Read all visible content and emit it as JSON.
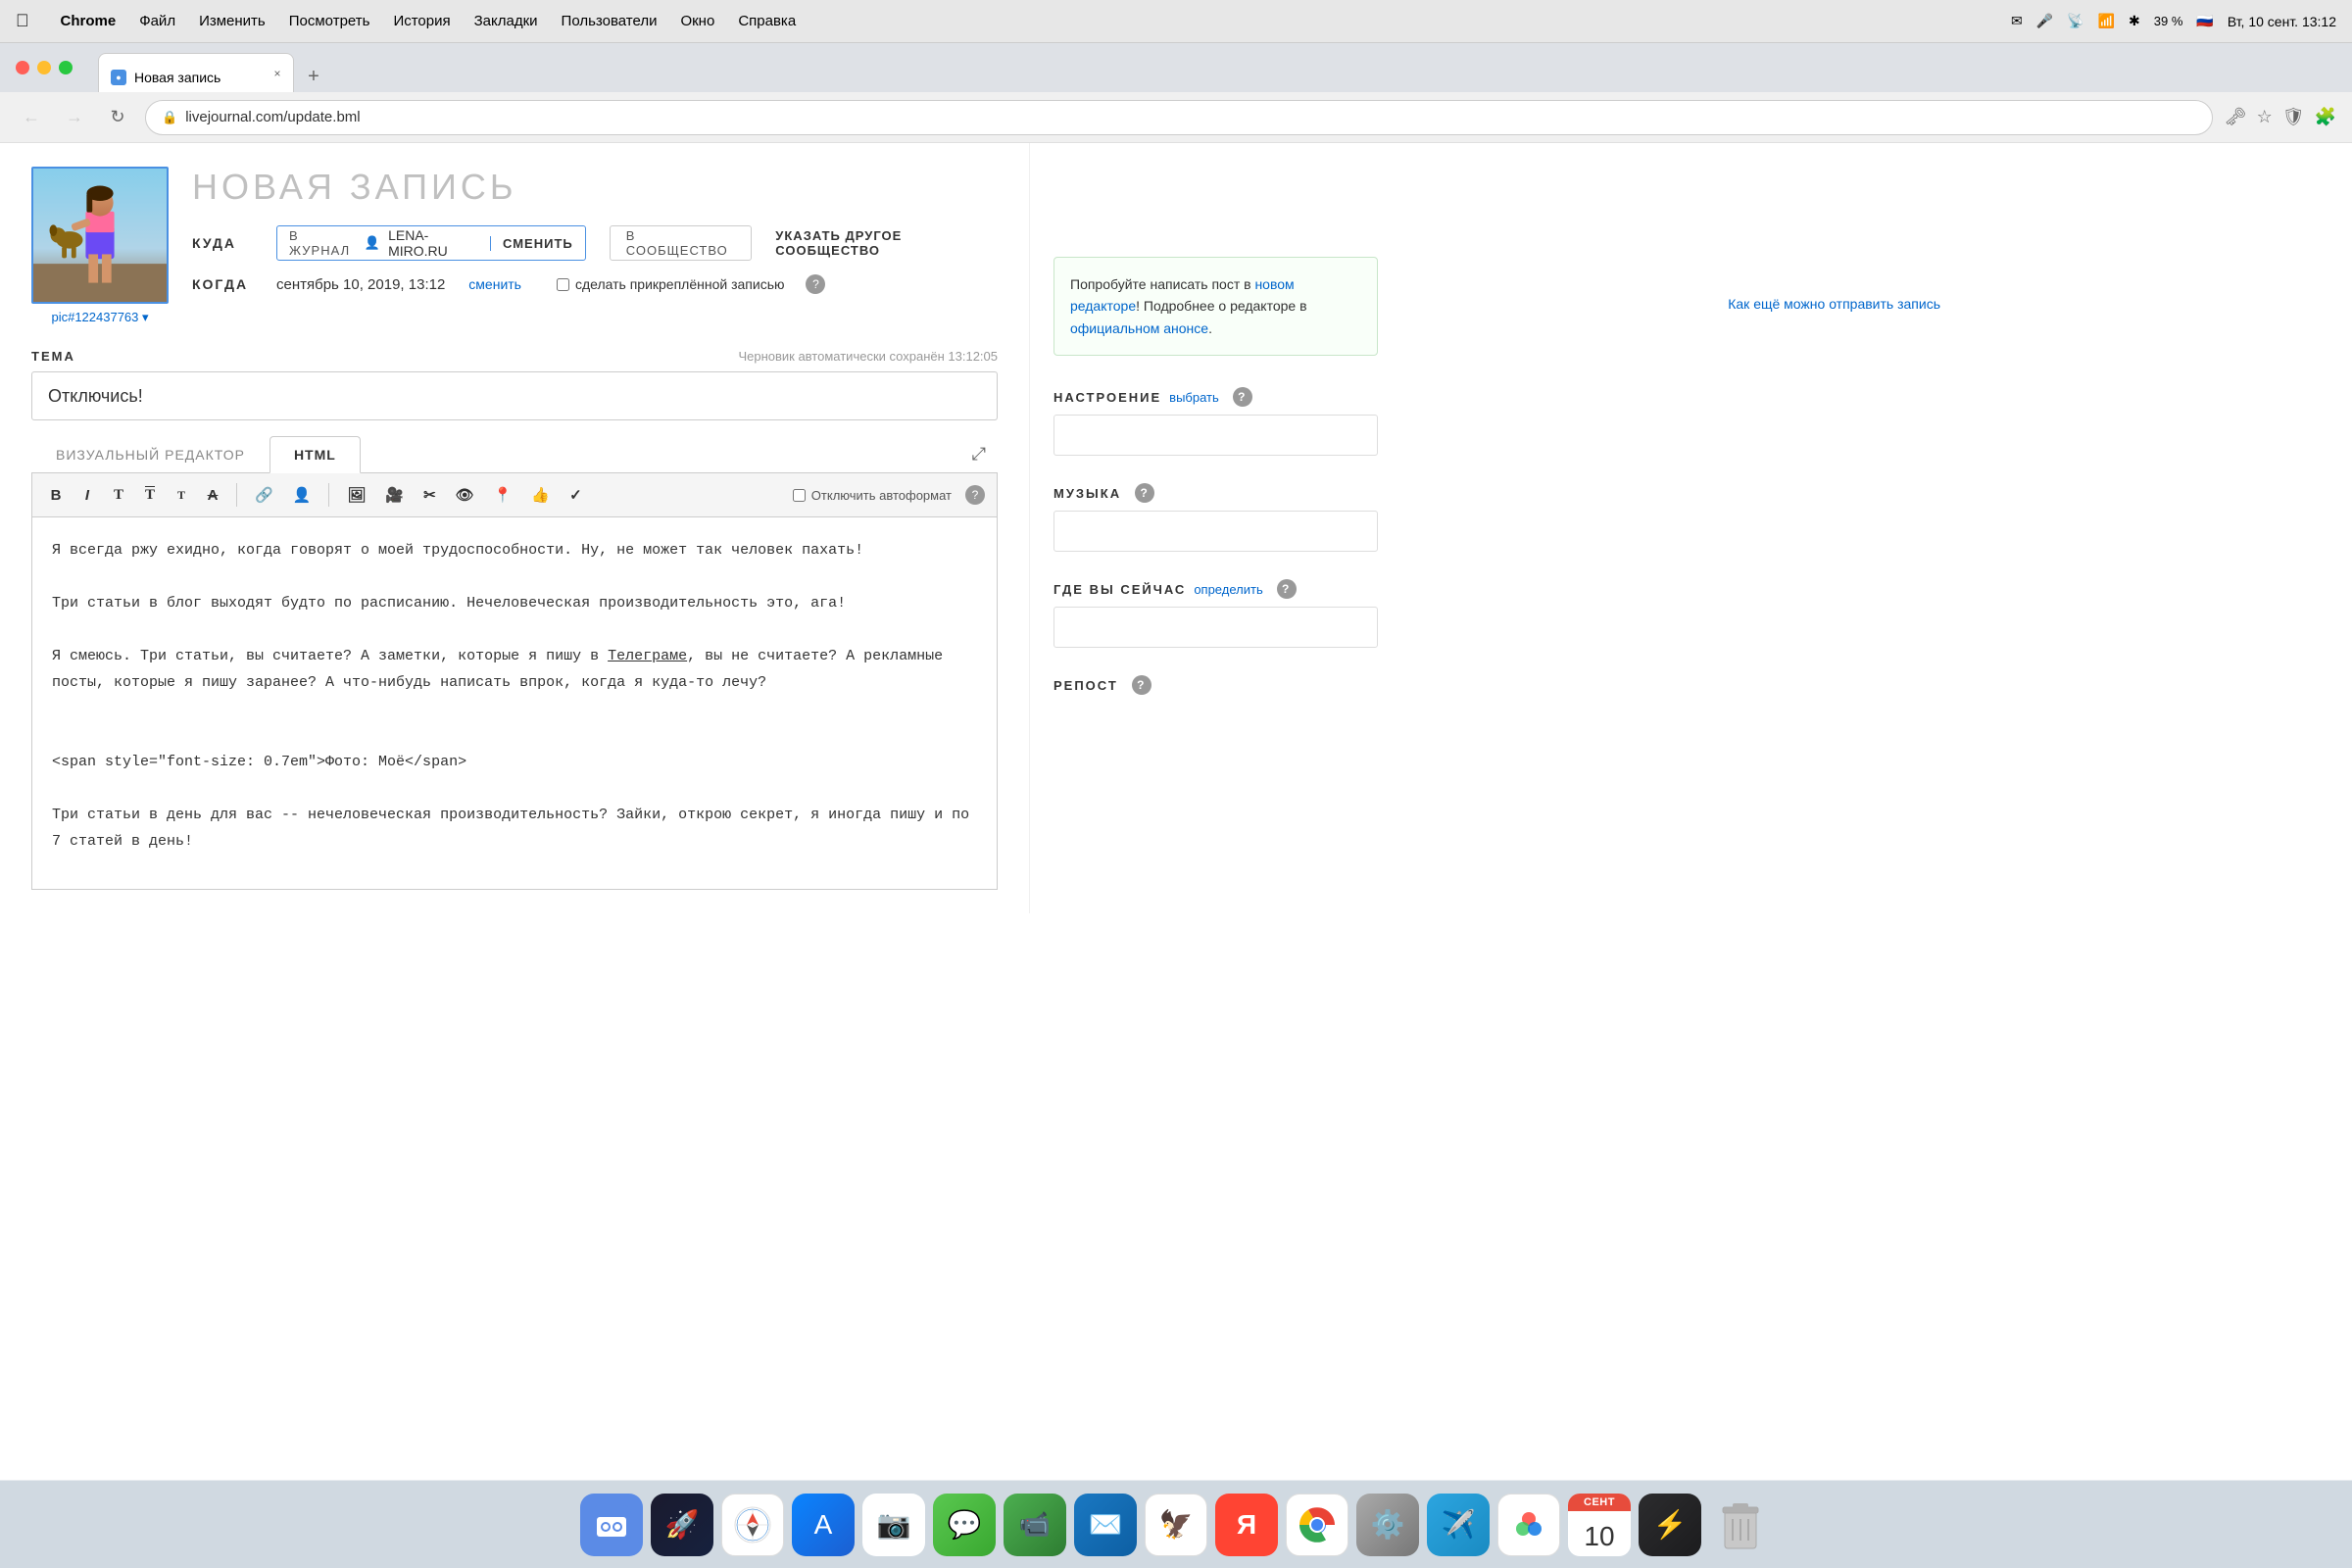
{
  "menubar": {
    "apple": "",
    "items": [
      "Chrome",
      "Файл",
      "Изменить",
      "Посмотреть",
      "История",
      "Закладки",
      "Пользователи",
      "Окно",
      "Справка"
    ],
    "right": {
      "battery": "39 %",
      "datetime": "Вт, 10 сент. 13:12",
      "flag": "🇷🇺"
    }
  },
  "tab": {
    "title": "Новая запись",
    "close": "×",
    "new": "+"
  },
  "addressbar": {
    "url": "livejournal.com/update.bml"
  },
  "header": {
    "title": "НОВАЯ ЗАПИСЬ",
    "top_link": "Как ещё можно отправить запись",
    "avatar_label": "pic#122437763 ▾"
  },
  "kuda": {
    "label": "КУДА",
    "journal_prefix": "В ЖУРНАЛ",
    "username": "LENA-MIRO.RU",
    "change": "СМЕНИТЬ",
    "community": "В СООБЩЕСТВО",
    "specify": "УКАЗАТЬ ДРУГОЕ СООБЩЕСТВО"
  },
  "kogda": {
    "label": "КОГДА",
    "date": "сентябрь 10, 2019, 13:12",
    "change": "сменить",
    "pinned": "сделать прикреплённой записью"
  },
  "tema": {
    "label": "ТЕМА",
    "autosave": "Черновик автоматически сохранён 13:12:05",
    "value": "Отключись!"
  },
  "editor": {
    "tab_visual": "ВИЗУАЛЬНЫЙ РЕДАКТОР",
    "tab_html": "HTML",
    "autoformat_label": "Отключить автоформат",
    "toolbar": {
      "bold": "B",
      "italic": "I",
      "t1": "T",
      "t2": "T̄",
      "t3": "T̈",
      "strikethrough": "A",
      "link": "🔗",
      "person": "👤",
      "image": "🖼",
      "video": "📹",
      "scissors": "✂",
      "eye": "👁",
      "location": "📍",
      "thumb_up": "👍",
      "check": "✓"
    },
    "content": "Я всегда ржу ехидно, когда говорят о моей трудоспособности. Ну, не может так человек пахать!\n\nТри статьи в блог выходят будто по расписанию. Нечеловеческая производительность это, ага!\n\nЯ смеюсь. Три статьи, вы считаете? А заметки, которые я пишу в Телеграме, вы не считаете? А рекламные посты, которые я пишу заранее? А что-нибудь написать впрок, когда я куда-то лечу?\n\n\n<span style=\"font-size: 0.7em\">Фото: Моё</span>\n\nТри статьи в день для вас -- нечеловеческая производительность? Зайки, открою секрет, я иногда пишу и по 7 статей в день!"
  },
  "sidebar": {
    "suggestion": {
      "text1": "Попробуйте написать пост в ",
      "link1": "новом редакторе",
      "text2": "!\nПодробнее о редакторе в ",
      "link2": "официальном анонсе",
      "text3": "."
    },
    "nastroenie": {
      "label": "НАСТРОЕНИЕ",
      "action": "выбрать"
    },
    "muzyka": {
      "label": "МУЗЫКА"
    },
    "gde": {
      "label": "ГДЕ ВЫ СЕЙЧАС",
      "action": "определить"
    },
    "repost": {
      "label": "РЕПОСТ"
    }
  },
  "dock": {
    "items": [
      {
        "icon": "🔍",
        "label": "finder",
        "bg": "#5b8be6"
      },
      {
        "icon": "🚀",
        "label": "launchpad",
        "bg": "#e8f4f8"
      },
      {
        "icon": "🧭",
        "label": "safari",
        "bg": "#fff"
      },
      {
        "icon": "📱",
        "label": "appstore",
        "bg": "#1c90f3"
      },
      {
        "icon": "📸",
        "label": "photos",
        "bg": "#f0a0a0"
      },
      {
        "icon": "💬",
        "label": "messages",
        "bg": "#5ac850"
      },
      {
        "icon": "📹",
        "label": "facetime",
        "bg": "#4caf50"
      },
      {
        "icon": "✉️",
        "label": "mail",
        "bg": "#fff"
      },
      {
        "icon": "🦅",
        "label": "twitter",
        "bg": "#1da1f2"
      },
      {
        "icon": "🦊",
        "label": "yandex",
        "bg": "#ff4433"
      },
      {
        "icon": "🌐",
        "label": "chrome",
        "bg": "#fff"
      },
      {
        "icon": "⚙️",
        "label": "settings",
        "bg": "#aaa"
      },
      {
        "icon": "✈️",
        "label": "telegram",
        "bg": "#2ca5e0"
      },
      {
        "icon": "🎨",
        "label": "colors",
        "bg": "linear-gradient(135deg,#f00,#0f0,#00f)"
      },
      {
        "icon": "📅",
        "label": "calendar",
        "date_top": "СЕНТ",
        "date_num": "10"
      },
      {
        "icon": "⚡",
        "label": "quicktime",
        "bg": "#333"
      },
      {
        "icon": "🗑",
        "label": "trash",
        "bg": "#c0c0c0"
      }
    ]
  }
}
